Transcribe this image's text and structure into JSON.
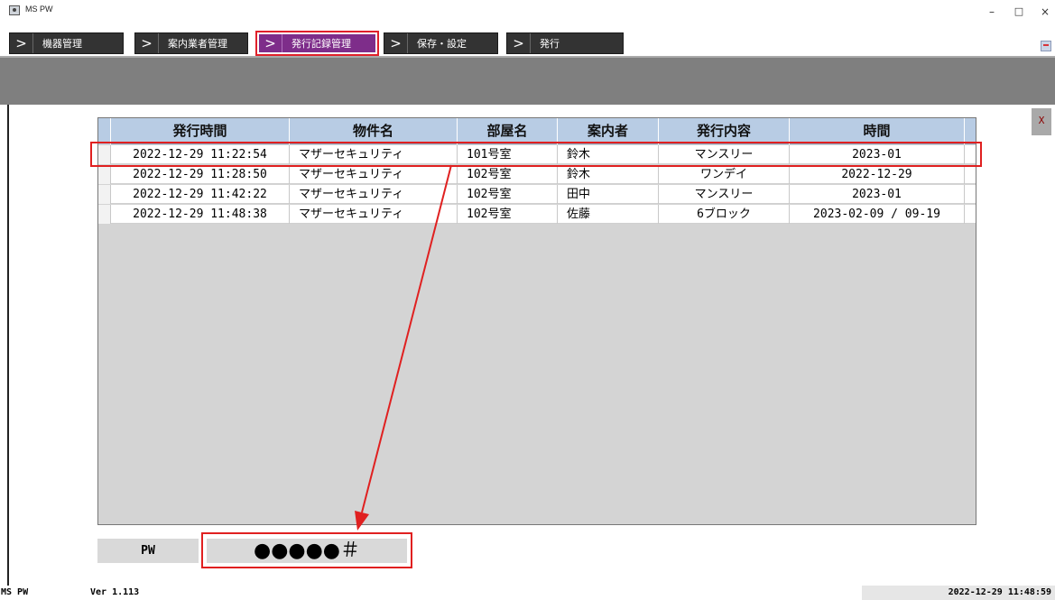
{
  "window": {
    "title": "MS PW",
    "controls": {
      "minimize": "–",
      "maximize": "□",
      "close": "×"
    }
  },
  "menu": {
    "chevron": ">",
    "items": [
      {
        "label": "機器管理",
        "active": false
      },
      {
        "label": "案内業者管理",
        "active": false
      },
      {
        "label": "発行記録管理",
        "active": true
      },
      {
        "label": "保存・設定",
        "active": false
      },
      {
        "label": "発行",
        "active": false
      }
    ]
  },
  "panel": {
    "close_label": "X"
  },
  "table": {
    "columns": [
      "発行時間",
      "物件名",
      "部屋名",
      "案内者",
      "発行内容",
      "時間"
    ],
    "rows": [
      [
        "2022-12-29 11:22:54",
        "マザーセキュリティ",
        "101号室",
        "鈴木",
        "マンスリー",
        "2023-01"
      ],
      [
        "2022-12-29 11:28:50",
        "マザーセキュリティ",
        "102号室",
        "鈴木",
        "ワンデイ",
        "2022-12-29"
      ],
      [
        "2022-12-29 11:42:22",
        "マザーセキュリティ",
        "102号室",
        "田中",
        "マンスリー",
        "2023-01"
      ],
      [
        "2022-12-29 11:48:38",
        "マザーセキュリティ",
        "102号室",
        "佐藤",
        "6ブロック",
        "2023-02-09 / 09-19"
      ]
    ],
    "highlighted_row_index": 0
  },
  "pw": {
    "label": "PW",
    "value": "●●●●●＃"
  },
  "status": {
    "app": "MS PW",
    "version": "Ver 1.113",
    "datetime": "2022-12-29 11:48:59"
  },
  "colors": {
    "active_tab": "#7e2d8a",
    "tab": "#333333",
    "header": "#b8cce4",
    "highlight": "#e02020",
    "band": "#7f7f7f"
  }
}
